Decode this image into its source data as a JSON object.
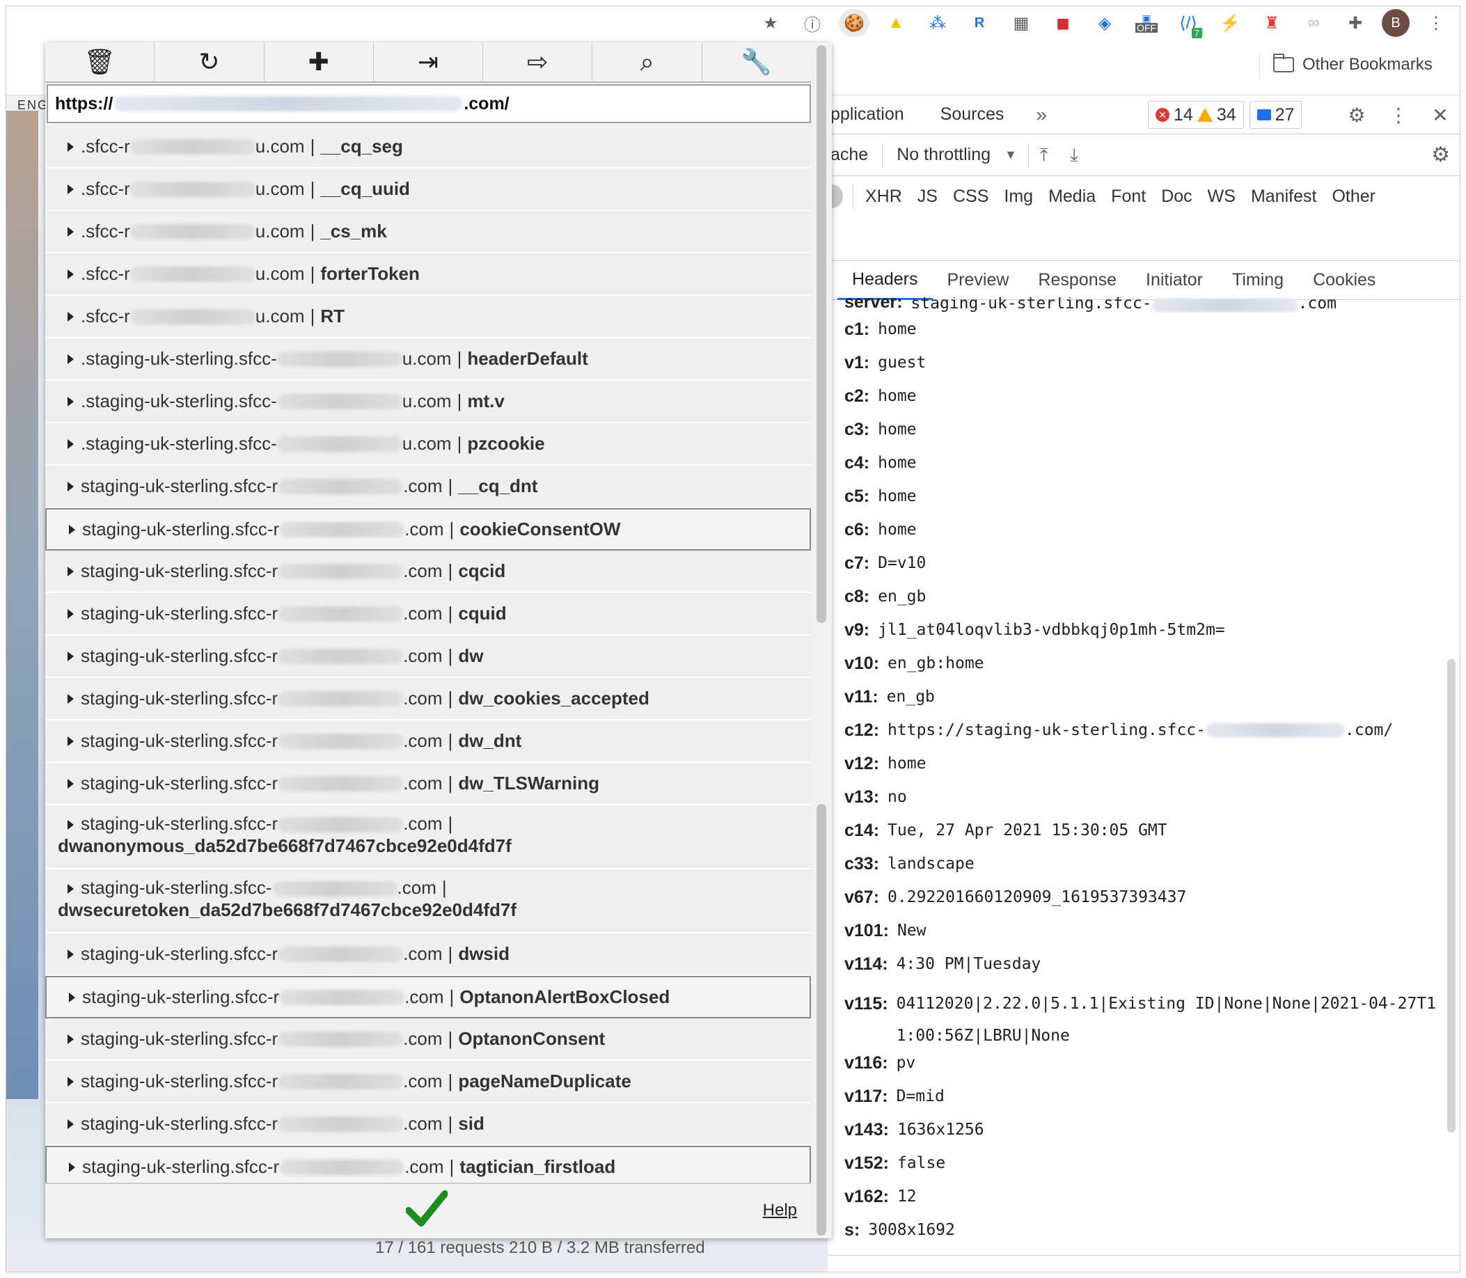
{
  "extensions": [
    "star-icon",
    "1password-icon",
    "cookie-icon",
    "drive-icon",
    "bitly-icon",
    "r-icon",
    "chart-icon",
    "acrobat-icon",
    "tag-icon",
    "off-icon",
    "code-icon",
    "plug-icon",
    "lighthouse-icon",
    "link-icon",
    "puzzle-icon"
  ],
  "extension_badges": {
    "off": "OFF",
    "code": "7"
  },
  "profile_initial": "B",
  "bookmarks": {
    "other": "Other Bookmarks"
  },
  "page": {
    "lang_label": "ENG"
  },
  "popup": {
    "url_prefix": "https://",
    "url_suffix": ".com/",
    "help": "Help",
    "cookies": [
      {
        "domain_prefix": ".sfcc-r",
        "domain_suffix": "u.com",
        "name": "__cq_seg"
      },
      {
        "domain_prefix": ".sfcc-r",
        "domain_suffix": "u.com",
        "name": "__cq_uuid"
      },
      {
        "domain_prefix": ".sfcc-r",
        "domain_suffix": "u.com",
        "name": "_cs_mk"
      },
      {
        "domain_prefix": ".sfcc-r",
        "domain_suffix": "u.com",
        "name": "forterToken"
      },
      {
        "domain_prefix": ".sfcc-r",
        "domain_suffix": "u.com",
        "name": "RT"
      },
      {
        "domain_prefix": ".staging-uk-sterling.sfcc-",
        "domain_suffix": "u.com",
        "name": "headerDefault"
      },
      {
        "domain_prefix": ".staging-uk-sterling.sfcc-",
        "domain_suffix": "u.com",
        "name": "mt.v"
      },
      {
        "domain_prefix": ".staging-uk-sterling.sfcc-",
        "domain_suffix": "u.com",
        "name": "pzcookie"
      },
      {
        "domain_prefix": "staging-uk-sterling.sfcc-r",
        "domain_suffix": ".com",
        "name": "__cq_dnt"
      },
      {
        "domain_prefix": "staging-uk-sterling.sfcc-r",
        "domain_suffix": ".com",
        "name": "cookieConsentOW",
        "selected": true
      },
      {
        "domain_prefix": "staging-uk-sterling.sfcc-r",
        "domain_suffix": ".com",
        "name": "cqcid"
      },
      {
        "domain_prefix": "staging-uk-sterling.sfcc-r",
        "domain_suffix": ".com",
        "name": "cquid"
      },
      {
        "domain_prefix": "staging-uk-sterling.sfcc-r",
        "domain_suffix": ".com",
        "name": "dw"
      },
      {
        "domain_prefix": "staging-uk-sterling.sfcc-r",
        "domain_suffix": ".com",
        "name": "dw_cookies_accepted"
      },
      {
        "domain_prefix": "staging-uk-sterling.sfcc-r",
        "domain_suffix": ".com",
        "name": "dw_dnt"
      },
      {
        "domain_prefix": "staging-uk-sterling.sfcc-r",
        "domain_suffix": ".com",
        "name": "dw_TLSWarning"
      },
      {
        "domain_prefix": "staging-uk-sterling.sfcc-r",
        "domain_suffix": ".com",
        "name": "dwanonymous_da52d7be668f7d7467cbce92e0d4fd7f",
        "tall": true
      },
      {
        "domain_prefix": "staging-uk-sterling.sfcc-",
        "domain_suffix": ".com",
        "name": "dwsecuretoken_da52d7be668f7d7467cbce92e0d4fd7f",
        "tall": true
      },
      {
        "domain_prefix": "staging-uk-sterling.sfcc-r",
        "domain_suffix": ".com",
        "name": "dwsid"
      },
      {
        "domain_prefix": "staging-uk-sterling.sfcc-r",
        "domain_suffix": ".com",
        "name": "OptanonAlertBoxClosed",
        "selected": true
      },
      {
        "domain_prefix": "staging-uk-sterling.sfcc-r",
        "domain_suffix": ".com",
        "name": "OptanonConsent"
      },
      {
        "domain_prefix": "staging-uk-sterling.sfcc-r",
        "domain_suffix": ".com",
        "name": "pageNameDuplicate"
      },
      {
        "domain_prefix": "staging-uk-sterling.sfcc-r",
        "domain_suffix": ".com",
        "name": "sid"
      },
      {
        "domain_prefix": "staging-uk-sterling.sfcc-r",
        "domain_suffix": ".com",
        "name": "tagtician_firstload",
        "selected": true
      }
    ]
  },
  "devtools": {
    "tabs": [
      "pplication",
      "Sources"
    ],
    "more": "»",
    "errors": "14",
    "warnings": "34",
    "messages": "27",
    "cache_label": "ache",
    "throttling": "No throttling",
    "filters": [
      "XHR",
      "JS",
      "CSS",
      "Img",
      "Media",
      "Font",
      "Doc",
      "WS",
      "Manifest",
      "Other"
    ],
    "subtabs": [
      "Headers",
      "Preview",
      "Response",
      "Initiator",
      "Timing",
      "Cookies"
    ],
    "server_prefix": "staging-uk-sterling.sfcc-",
    "server_suffix": ".com",
    "params": [
      {
        "key": "c1:",
        "value": "home"
      },
      {
        "key": "v1:",
        "value": "guest"
      },
      {
        "key": "c2:",
        "value": "home"
      },
      {
        "key": "c3:",
        "value": "home"
      },
      {
        "key": "c4:",
        "value": "home"
      },
      {
        "key": "c5:",
        "value": "home"
      },
      {
        "key": "c6:",
        "value": "home"
      },
      {
        "key": "c7:",
        "value": "D=v10"
      },
      {
        "key": "c8:",
        "value": "en_gb"
      },
      {
        "key": "v9:",
        "value": "jl1_at04loqvlib3-vdbbkqj0p1mh-5tm2m="
      },
      {
        "key": "v10:",
        "value": "en_gb:home"
      },
      {
        "key": "v11:",
        "value": "en_gb"
      },
      {
        "key": "c12:",
        "value": "https://staging-uk-sterling.sfcc-",
        "suffix": ".com/"
      },
      {
        "key": "v12:",
        "value": "home"
      },
      {
        "key": "v13:",
        "value": "no"
      },
      {
        "key": "c14:",
        "value": "Tue, 27 Apr 2021 15:30:05 GMT"
      },
      {
        "key": "c33:",
        "value": "landscape"
      },
      {
        "key": "v67:",
        "value": "0.292201660120909_1619537393437"
      },
      {
        "key": "v101:",
        "value": "New"
      },
      {
        "key": "v114:",
        "value": "4:30 PM|Tuesday"
      },
      {
        "key": "v115:",
        "value": "04112020|2.22.0|5.1.1|Existing ID|None|None|2021-04-27T11:00:56Z|LBRU|None",
        "wrap": true
      },
      {
        "key": "v116:",
        "value": "pv"
      },
      {
        "key": "v117:",
        "value": "D=mid"
      },
      {
        "key": "v143:",
        "value": "1636x1256"
      },
      {
        "key": "v152:",
        "value": "false"
      },
      {
        "key": "v162:",
        "value": "12"
      },
      {
        "key": "s:",
        "value": "3008x1692"
      }
    ],
    "status_behind": "17 / 161 requests   210 B / 3.2 MB transferred"
  }
}
